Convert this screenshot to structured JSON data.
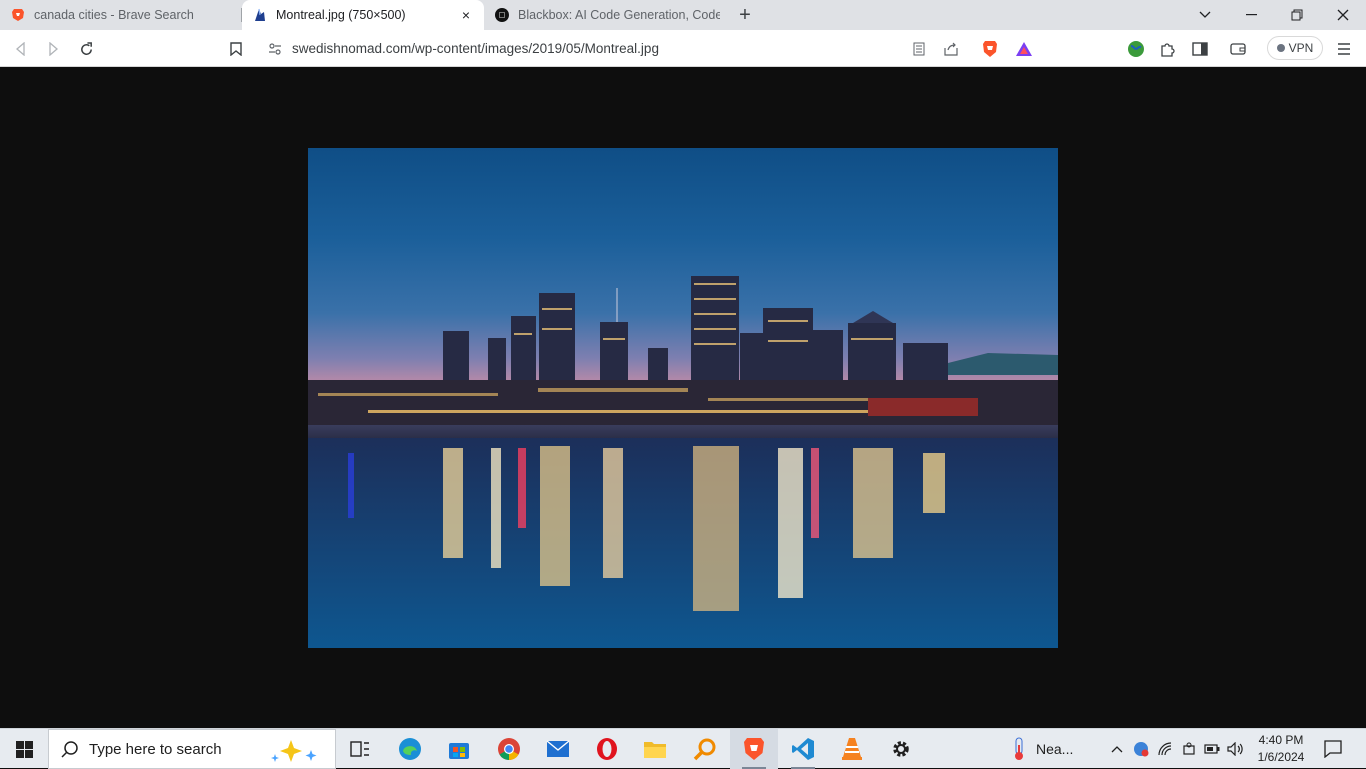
{
  "tabs": [
    {
      "title": "canada cities - Brave Search",
      "icon": "brave-lion-icon"
    },
    {
      "title": "Montreal.jpg (750×500)",
      "icon": "montreal-favicon-icon",
      "active": true,
      "close": "×"
    },
    {
      "title": "Blackbox: AI Code Generation, Code C",
      "icon": "blackbox-icon"
    }
  ],
  "new_tab": "+",
  "address": {
    "url": "swedishnomad.com/wp-content/images/2019/05/Montreal.jpg"
  },
  "vpn_label": "VPN",
  "image": {
    "alt": "Montreal skyline at night reflected in the river"
  },
  "taskbar": {
    "search_placeholder": "Type here to search",
    "weather_label": "Nea...",
    "time": "4:40 PM",
    "date": "1/6/2024"
  },
  "colors": {
    "tabstrip": "#dfe1e5",
    "brave": "#fb542b",
    "accent": "#0078d4"
  }
}
